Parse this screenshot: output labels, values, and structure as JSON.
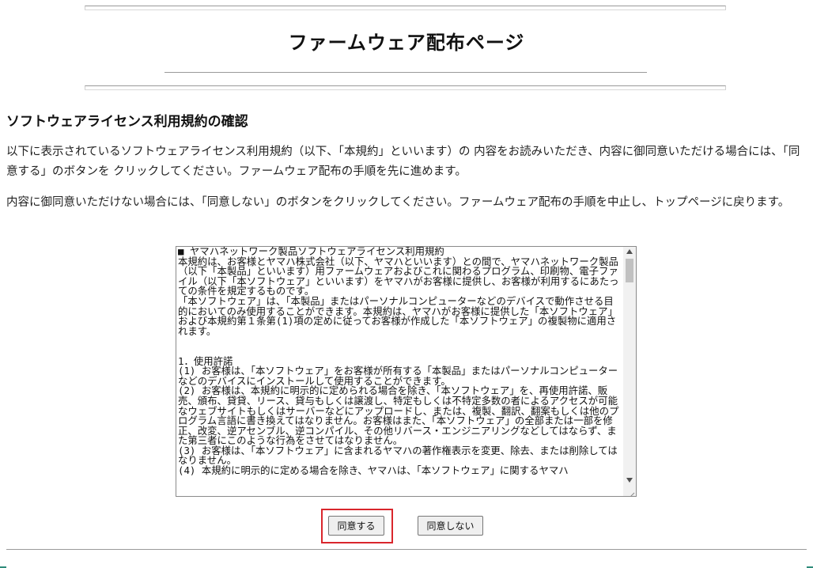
{
  "page": {
    "title": "ファームウェア配布ページ"
  },
  "section": {
    "title": "ソフトウェアライセンス利用規約の確認",
    "paragraph1": "以下に表示されているソフトウェアライセンス利用規約（以下、「本規約」といいます）の 内容をお読みいただき、内容に御同意いただける場合には、「同意する」のボタンを クリックしてください。ファームウェア配布の手順を先に進めます。",
    "paragraph2": "内容に御同意いただけない場合には、「同意しない」のボタンをクリックしてください。ファームウェア配布の手順を中止し、トップページに戻ります。"
  },
  "license": {
    "text": "■ ヤマハネットワーク製品ソフトウェアライセンス利用規約\n本規約は、お客様とヤマハ株式会社（以下、ヤマハといいます）との間で、ヤマハネットワーク製品（以下「本製品」といいます）用ファームウェアおよびこれに関わるプログラム、印刷物、電子ファイル（以下「本ソフトウェア」といいます）をヤマハがお客様に提供し、お客様が利用するにあたっての条件を規定するものです。\n「本ソフトウェア」は、「本製品」またはパーソナルコンピューターなどのデバイスで動作させる目的においてのみ使用することができます。本規約は、ヤマハがお客様に提供した「本ソフトウェア」および本規約第１条第(1)項の定めに従ってお客様が作成した「本ソフトウェア」の複製物に適用されます。\n\n\n1．使用許諾\n(1) お客様は、「本ソフトウェア」をお客様が所有する「本製品」またはパーソナルコンピューターなどのデバイスにインストールして使用することができます。\n(2) お客様は、本規約に明示的に定められる場合を除き、「本ソフトウェア」を、再使用許諾、販売、頒布、貸貸、リース、貸与もしくは譲渡し、特定もしくは不特定多数の者によるアクセスが可能なウェブサイトもしくはサーバーなどにアップロードし、または、複製、翻訳、翻案もしくは他のプログラム言語に書き換えてはなりません。お客様はまた、「本ソフトウェア」の全部または一部を修正、改変、逆アセンブル、逆コンパイル、その他リバース・エンジニアリングなどしてはならず、また第三者にこのような行為をさせてはなりません。\n(3) お客様は、「本ソフトウェア」に含まれるヤマハの著作権表示を変更、除去、または削除してはなりません。\n(4) 本規約に明示的に定める場合を除き、ヤマハは、「本ソフトウェア」に関するヤマハ"
  },
  "buttons": {
    "agree_label": "同意する",
    "disagree_label": "同意しない"
  },
  "colors": {
    "highlight": "#d9262c",
    "edge_accent": "#2e8b7a"
  },
  "icons": {
    "scroll_up": "scroll-up-arrow",
    "scroll_down": "scroll-down-arrow",
    "resize": "resize-grip"
  }
}
